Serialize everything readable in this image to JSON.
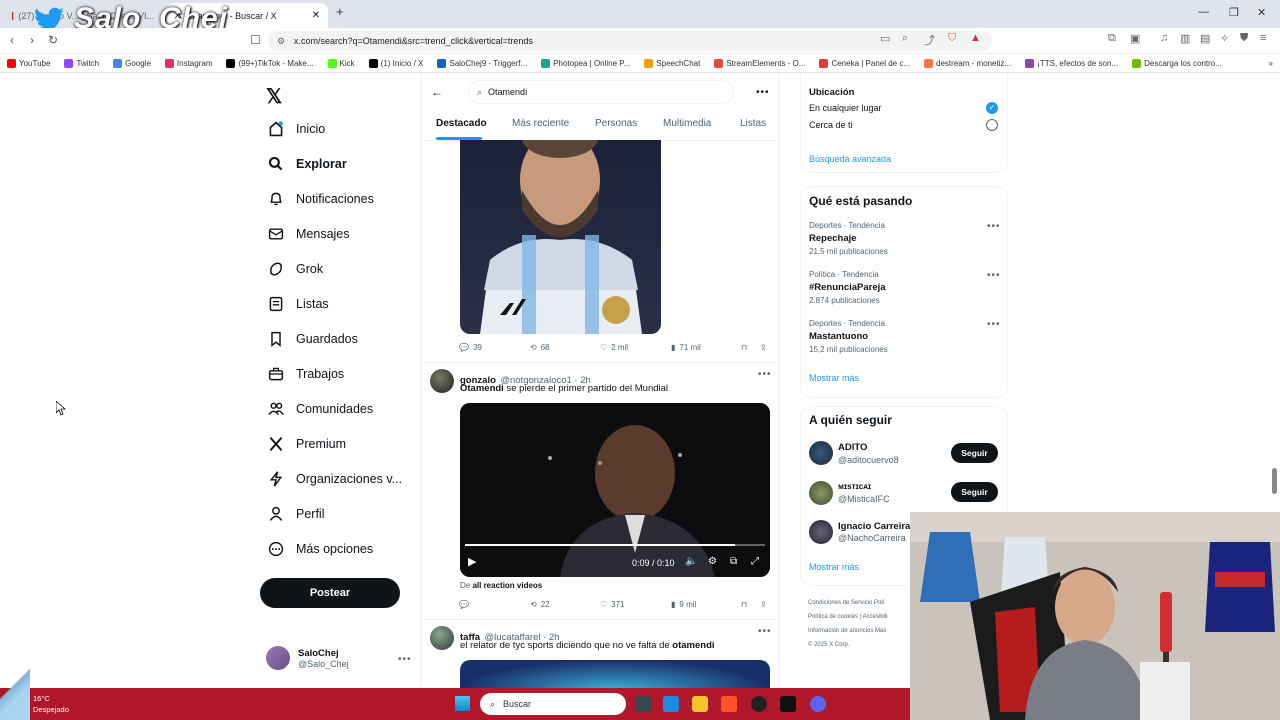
{
  "browser": {
    "tabs": [
      {
        "label": "(27) Cuarto V... | Salo_Chej... VI..."
      },
      {
        "label": "Otamendi - Buscar / X"
      }
    ],
    "url": "x.com/search?q=Otamendi&src=trend_click&vertical=trends",
    "bookmarks": [
      {
        "label": "YouTube",
        "color": "#ff0000"
      },
      {
        "label": "Twitch",
        "color": "#9146ff"
      },
      {
        "label": "Google",
        "color": "#4285f4"
      },
      {
        "label": "Instagram",
        "color": "#e1306c"
      },
      {
        "label": "(99+)TikTok - Make...",
        "color": "#000000"
      },
      {
        "label": "Kick",
        "color": "#53fc18"
      },
      {
        "label": "(1) Inicio / X",
        "color": "#000000"
      },
      {
        "label": "SaloChej9 - Triggerf...",
        "color": "#1565c0"
      },
      {
        "label": "Photopea | Online P...",
        "color": "#18a497"
      },
      {
        "label": "SpeechChat",
        "color": "#f39c12"
      },
      {
        "label": "StreamElements - O...",
        "color": "#e74c3c"
      },
      {
        "label": "Ceneka | Panel de c...",
        "color": "#e53935"
      },
      {
        "label": "destream - monetiz...",
        "color": "#ff7043"
      },
      {
        "label": "¡TTS, efectos de son...",
        "color": "#8e44ad"
      },
      {
        "label": "Descarga los contro...",
        "color": "#76b900"
      }
    ]
  },
  "watermark": "Salo_Chej",
  "x_nav": {
    "items": [
      {
        "label": "Inicio",
        "icon": "home-icon"
      },
      {
        "label": "Explorar",
        "icon": "search-icon"
      },
      {
        "label": "Notificaciones",
        "icon": "bell-icon"
      },
      {
        "label": "Mensajes",
        "icon": "envelope-icon"
      },
      {
        "label": "Grok",
        "icon": "grok-icon"
      },
      {
        "label": "Listas",
        "icon": "list-icon"
      },
      {
        "label": "Guardados",
        "icon": "bookmark-icon"
      },
      {
        "label": "Trabajos",
        "icon": "briefcase-icon"
      },
      {
        "label": "Comunidades",
        "icon": "people-icon"
      },
      {
        "label": "Premium",
        "icon": "x-icon"
      },
      {
        "label": "Organizaciones v...",
        "icon": "bolt-icon"
      },
      {
        "label": "Perfil",
        "icon": "person-icon"
      },
      {
        "label": "Más opciones",
        "icon": "more-icon"
      }
    ],
    "post_button": "Postear",
    "profile": {
      "name": "SaloChej",
      "handle": "@Salo_Chej"
    }
  },
  "search": {
    "query": "Otamendi",
    "tabs": [
      "Destacado",
      "Más reciente",
      "Personas",
      "Multimedia",
      "Listas"
    ]
  },
  "tweets": [
    {
      "stats": {
        "replies": "39",
        "retweets": "68",
        "likes": "2 mil",
        "views": "71 mil"
      }
    },
    {
      "name": "gonzalo",
      "handle": "@notgonzaloco1 · 2h",
      "text_bold": "Otamendi",
      "text_rest": " se pierde el primer partido del Mundial",
      "video_time": "0:09 / 0:10",
      "source_prefix": "De ",
      "source": "all reaction videos",
      "stats": {
        "replies": "",
        "retweets": "22",
        "likes": "371",
        "views": "9 mil"
      }
    },
    {
      "name": "taffa",
      "handle": "@lucataffarel · 2h",
      "text_rest": "el relator de tyc sports diciendo que no ve falta de ",
      "text_bold": "otamendi"
    }
  ],
  "right": {
    "location": {
      "title": "Ubicación",
      "options": [
        "En cualquier lugar",
        "Cerca de ti"
      ],
      "advanced": "Búsqueda avanzada"
    },
    "trends": {
      "title": "Qué está pasando",
      "items": [
        {
          "category": "Deportes · Tendencia",
          "name": "Repechaje",
          "count": "21,5 mil publicaciones"
        },
        {
          "category": "Política · Tendencia",
          "name": "#RenunciaPareja",
          "count": "2.874 publicaciones"
        },
        {
          "category": "Deportes · Tendencia",
          "name": "Mastantuono",
          "count": "15,2 mil publicaciones"
        }
      ],
      "more": "Mostrar más"
    },
    "follow": {
      "title": "A quién seguir",
      "users": [
        {
          "name": "ADITO",
          "handle": "@aditocuervo8",
          "button": "Seguir"
        },
        {
          "name": "ᴍɪsᴛɪᴄᴀɪ",
          "handle": "@MisticaIFC",
          "button": "Seguir"
        },
        {
          "name": "Ignacio Carreira",
          "handle": "@NachoCarreira"
        }
      ],
      "more": "Mostrar más"
    },
    "footer": [
      "Condiciones de Servicio",
      "Polí",
      "Política de cookies",
      "Accesibili",
      "Información de anuncios",
      "Más",
      "© 2025 X Corp."
    ]
  },
  "taskbar": {
    "weather_temp": "16°C",
    "weather_desc": "Despejado",
    "search_placeholder": "Buscar"
  }
}
